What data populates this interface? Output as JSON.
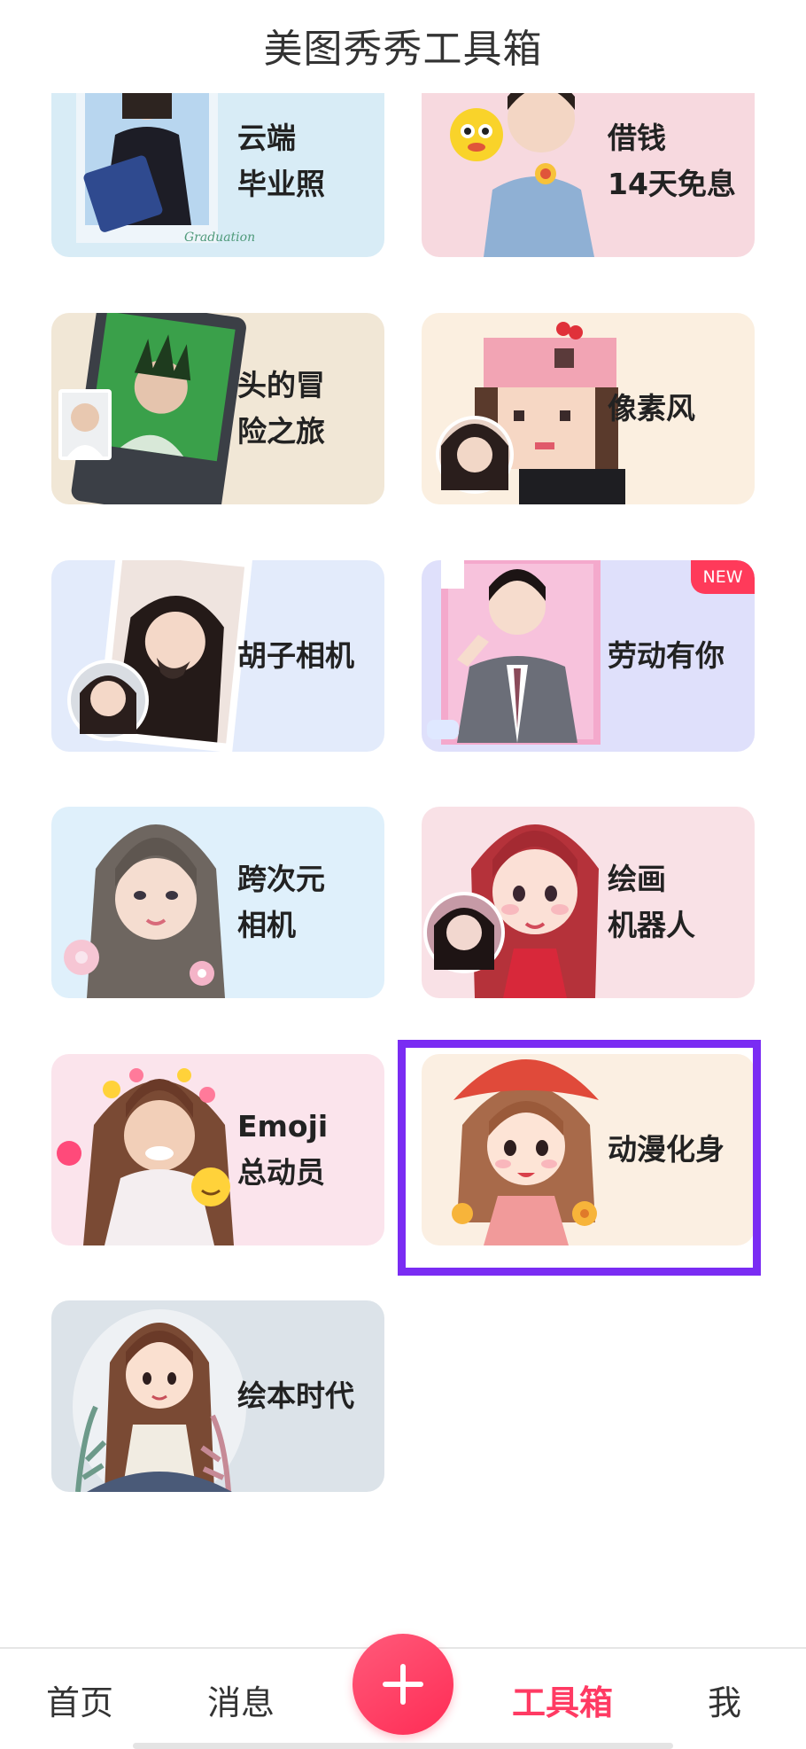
{
  "header": {
    "title": "美图秀秀工具箱"
  },
  "tools": [
    {
      "label": "云端\n毕业照",
      "bg": "#d8ecf6"
    },
    {
      "label": "借钱\n14天免息",
      "bg": "#f7d9df"
    },
    {
      "label": "头的冒\n险之旅",
      "bg": "#f1e7d6"
    },
    {
      "label": "像素风",
      "bg": "#fbefe0"
    },
    {
      "label": "胡子相机",
      "bg": "#e3ebfb"
    },
    {
      "label": "劳动有你",
      "bg": "#dfe0fb",
      "badge": "NEW"
    },
    {
      "label": "跨次元\n相机",
      "bg": "#dff0fb"
    },
    {
      "label": "绘画\n机器人",
      "bg": "#f9e1e6"
    },
    {
      "label": "Emoji\n总动员",
      "bg": "#fbe4ec"
    },
    {
      "label": "动漫化身",
      "bg": "#fbefe2"
    },
    {
      "label": "绘本时代",
      "bg": "#dce3e9"
    }
  ],
  "tabbar": {
    "home": "首页",
    "messages": "消息",
    "toolbox": "工具箱",
    "me": "我"
  },
  "colors": {
    "accent": "#ff3a63",
    "highlight": "#7a2cf3"
  }
}
